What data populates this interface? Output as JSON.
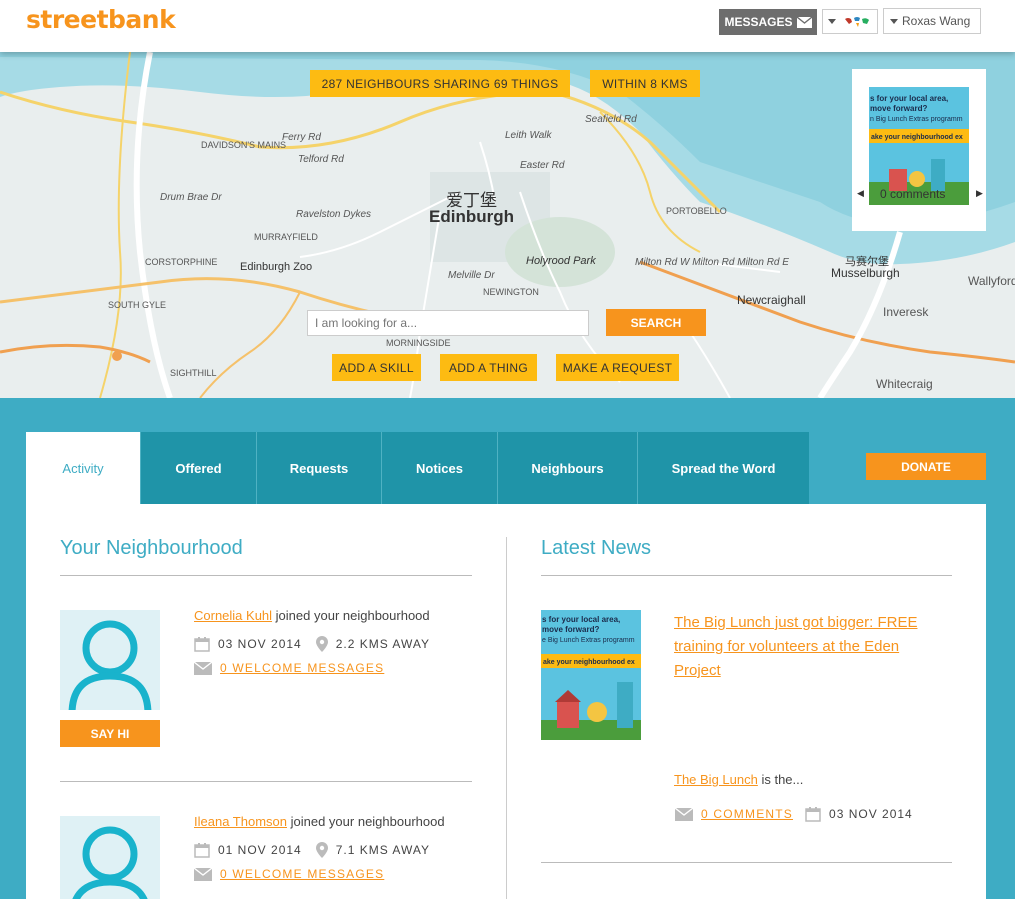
{
  "header": {
    "logo": "streetbank",
    "messages_label": "MESSAGES",
    "user_name": "Roxas Wang"
  },
  "map": {
    "stats_pill": "287 NEIGHBOURS SHARING 69 THINGS",
    "radius_pill": "WITHIN 8 KMS",
    "city_chinese": "爱丁堡",
    "city_name": "Edinburgh",
    "places": {
      "davidsons_mains": "DAVIDSON'S MAINS",
      "murrayfield": "MURRAYFIELD",
      "corstorphine": "CORSTORPHINE",
      "zoo": "Edinburgh Zoo",
      "holyrood": "Holyrood Park",
      "newington": "NEWINGTON",
      "morningside": "MORNINGSIDE",
      "portobello": "PORTOBELLO",
      "newcraighall": "Newcraighall",
      "musselburgh_cn": "马赛尔堡",
      "musselburgh": "Musselburgh",
      "inveresk": "Inveresk",
      "whitecraig": "Whitecraig",
      "wallyford": "Wallyford",
      "south_gyle": "SOUTH GYLE",
      "sighthill": "SIGHTHILL",
      "ferry_rd": "Ferry Rd",
      "telford_rd": "Telford Rd",
      "drum_brae": "Drum Brae Dr",
      "ravelston": "Ravelston Dykes",
      "seafield": "Seafield Rd",
      "leith_walk": "Leith Walk",
      "easter_rd": "Easter Rd",
      "melville": "Melville Dr",
      "milton": "Milton Rd W  Milton Rd  Milton Rd E"
    },
    "search_placeholder": "I am looking for a...",
    "search_button": "SEARCH",
    "add_skill": "ADD A SKILL",
    "add_thing": "ADD A THING",
    "make_request": "MAKE A REQUEST",
    "news_card": {
      "comments": "0 comments",
      "thumb_line1": "s for your local area,",
      "thumb_line2": "move forward?",
      "thumb_line3": "n Big Lunch Extras programm",
      "thumb_banner": "ake your neighbourhood ex"
    }
  },
  "tabs": [
    {
      "label": "Activity",
      "active": true
    },
    {
      "label": "Offered"
    },
    {
      "label": "Requests"
    },
    {
      "label": "Notices"
    },
    {
      "label": "Neighbours"
    },
    {
      "label": "Spread the Word"
    }
  ],
  "donate_label": "DONATE",
  "neighbourhood": {
    "title": "Your Neighbourhood",
    "say_hi": "SAY HI",
    "items": [
      {
        "name": "Cornelia Kuhl",
        "action": "joined your neighbourhood",
        "date": "03 NOV 2014",
        "distance": "2.2 KMS AWAY",
        "welcome": "0 WELCOME MESSAGES"
      },
      {
        "name": "Ileana Thomson",
        "action": "joined your neighbourhood",
        "date": "01 NOV 2014",
        "distance": "7.1 KMS AWAY",
        "welcome": "0 WELCOME MESSAGES"
      }
    ]
  },
  "news": {
    "title": "Latest News",
    "article_title": "The Big Lunch just got bigger: FREE training for volunteers at the Eden Project",
    "excerpt_link": "The Big Lunch",
    "excerpt_rest": " is the...",
    "comments": "0 COMMENTS",
    "date": "03 NOV 2014",
    "thumb_line1": "s for your local area,",
    "thumb_line2": "move forward?",
    "thumb_line3": "e Big Lunch Extras programm",
    "thumb_banner": "ake your neighbourhood ex"
  },
  "colors": {
    "brand_orange": "#f7941d",
    "pill_yellow": "#fdbb12",
    "teal": "#3eacc4",
    "tab_dark_teal": "#1f94a8"
  }
}
